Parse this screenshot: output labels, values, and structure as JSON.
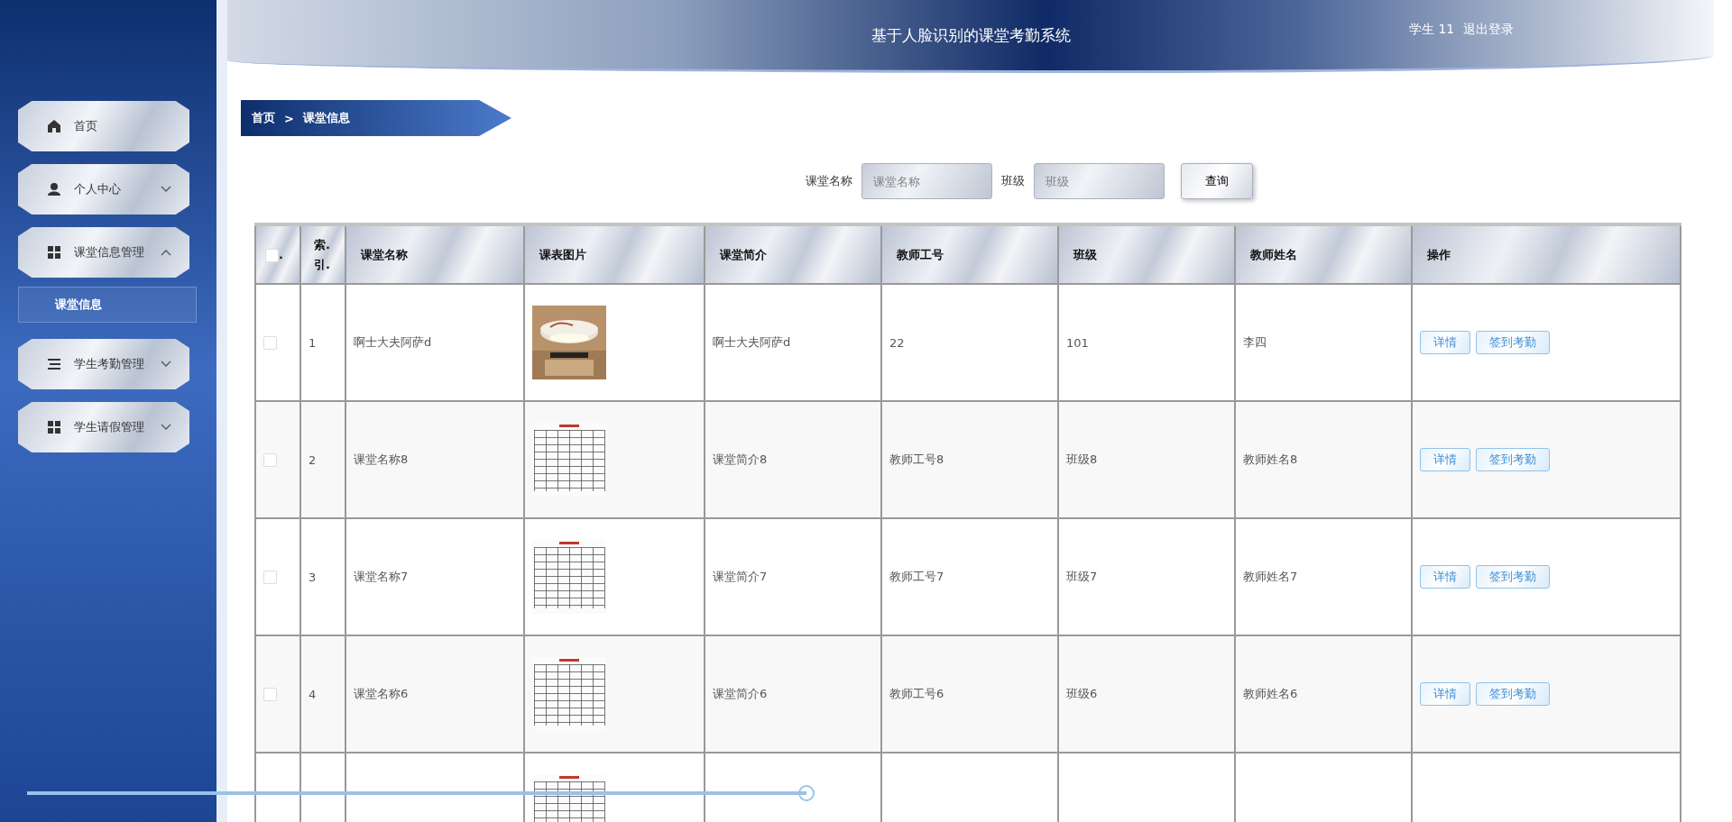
{
  "sidebar": {
    "items": [
      {
        "label": "首页",
        "selected": false
      },
      {
        "label": "个人中心",
        "expanded": false
      },
      {
        "label": "课堂信息管理",
        "expanded": true,
        "children": [
          {
            "label": "课堂信息",
            "selected": true
          }
        ]
      },
      {
        "label": "学生考勤管理",
        "expanded": false
      },
      {
        "label": "学生请假管理",
        "expanded": false
      }
    ]
  },
  "header": {
    "title": "基于人脸识别的课堂考勤系统",
    "user": "学生 11",
    "logout": "退出登录"
  },
  "breadcrumb": {
    "home": "首页",
    "separator": ">",
    "current": "课堂信息"
  },
  "search": {
    "fields": [
      {
        "label": "课堂名称",
        "placeholder": "课堂名称"
      },
      {
        "label": "班级",
        "placeholder": "班级"
      }
    ],
    "button": "查询"
  },
  "table": {
    "select_all": {
      "checked": false,
      "label": "."
    },
    "columns": [
      "索.引.",
      "课堂名称",
      "课表图片",
      "课堂简介",
      "教师工号",
      "班级",
      "教师姓名",
      "操作"
    ],
    "rows": [
      {
        "checked": false,
        "index": "1",
        "name": "啊士大夫阿萨d",
        "intro": "啊士大夫阿萨d",
        "teacher_no": "22",
        "class": "101",
        "teacher_name": "李四",
        "actions": [
          "详情",
          "签到考勤"
        ]
      },
      {
        "checked": false,
        "index": "2",
        "name": "课堂名称8",
        "image": {
          "kind": "timetable"
        },
        "intro": "课堂简介8",
        "teacher_no": "教师工号8",
        "class": "班级8",
        "teacher_name": "教师姓名8",
        "actions": [
          "详情",
          "签到考勤"
        ]
      },
      {
        "checked": false,
        "index": "3",
        "name": "课堂名称7",
        "image": {
          "kind": "timetable"
        },
        "intro": "课堂简介7",
        "teacher_no": "教师工号7",
        "class": "班级7",
        "teacher_name": "教师姓名7",
        "actions": [
          "详情",
          "签到考勤"
        ]
      },
      {
        "checked": false,
        "index": "4",
        "name": "课堂名称6",
        "image": {
          "kind": "timetable"
        },
        "intro": "课堂简介6",
        "teacher_no": "教师工号6",
        "class": "班级6",
        "teacher_name": "教师姓名6",
        "actions": [
          "详情",
          "签到考勤"
        ]
      },
      {
        "image": {
          "kind": "timetable"
        }
      }
    ]
  },
  "video_player": {
    "progress": {
      "level": 0.48
    }
  }
}
